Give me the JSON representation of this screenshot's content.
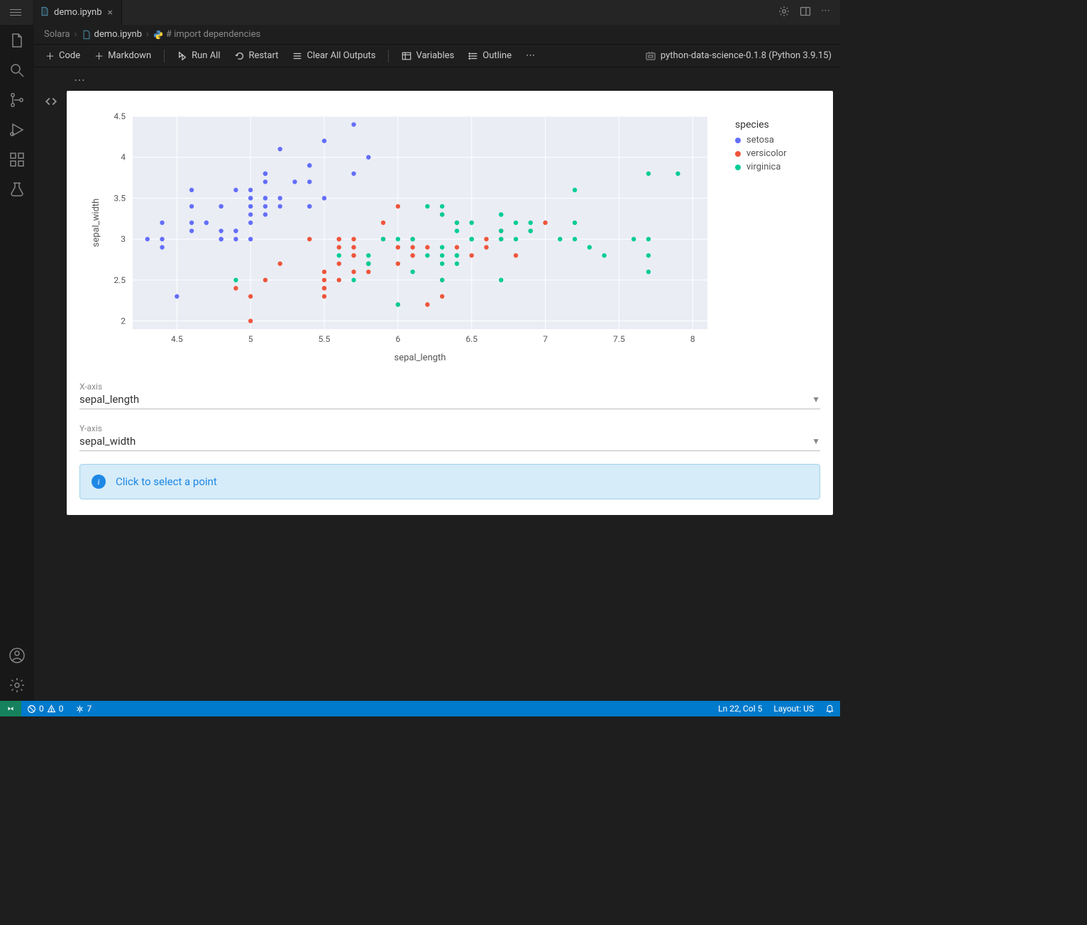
{
  "tab": {
    "title": "demo.ipynb"
  },
  "breadcrumb": {
    "root": "Solara",
    "file": "demo.ipynb",
    "symbol": "# import dependencies"
  },
  "toolbar": {
    "code": "Code",
    "markdown": "Markdown",
    "runall": "Run All",
    "restart": "Restart",
    "clear": "Clear All Outputs",
    "variables": "Variables",
    "outline": "Outline"
  },
  "kernel": {
    "name": "python-data-science-0.1.8 (Python 3.9.15)"
  },
  "chart": {
    "xlabel": "sepal_length",
    "ylabel": "sepal_width",
    "legend_title": "species",
    "legend": [
      "setosa",
      "versicolor",
      "virginica"
    ]
  },
  "chart_data": {
    "type": "scatter",
    "title": "",
    "xlabel": "sepal_length",
    "ylabel": "sepal_width",
    "xlim": [
      4.2,
      8.1
    ],
    "ylim": [
      1.9,
      4.5
    ],
    "xticks": [
      4.5,
      5,
      5.5,
      6,
      6.5,
      7,
      7.5,
      8
    ],
    "yticks": [
      2,
      2.5,
      3,
      3.5,
      4,
      4.5
    ],
    "legend_title": "species",
    "series": [
      {
        "name": "setosa",
        "color": "#636efa",
        "points": [
          [
            5.1,
            3.5
          ],
          [
            4.9,
            3.0
          ],
          [
            4.7,
            3.2
          ],
          [
            4.6,
            3.1
          ],
          [
            5.0,
            3.6
          ],
          [
            5.4,
            3.9
          ],
          [
            4.6,
            3.4
          ],
          [
            5.0,
            3.4
          ],
          [
            4.4,
            2.9
          ],
          [
            4.9,
            3.1
          ],
          [
            5.4,
            3.7
          ],
          [
            4.8,
            3.4
          ],
          [
            4.8,
            3.0
          ],
          [
            4.3,
            3.0
          ],
          [
            5.8,
            4.0
          ],
          [
            5.7,
            4.4
          ],
          [
            5.4,
            3.9
          ],
          [
            5.1,
            3.5
          ],
          [
            5.7,
            3.8
          ],
          [
            5.1,
            3.8
          ],
          [
            5.4,
            3.4
          ],
          [
            5.1,
            3.7
          ],
          [
            4.6,
            3.6
          ],
          [
            5.1,
            3.3
          ],
          [
            4.8,
            3.4
          ],
          [
            5.0,
            3.0
          ],
          [
            5.0,
            3.4
          ],
          [
            5.2,
            3.5
          ],
          [
            5.2,
            3.4
          ],
          [
            4.7,
            3.2
          ],
          [
            4.8,
            3.1
          ],
          [
            5.4,
            3.4
          ],
          [
            5.2,
            4.1
          ],
          [
            5.5,
            4.2
          ],
          [
            4.9,
            3.1
          ],
          [
            5.0,
            3.2
          ],
          [
            5.5,
            3.5
          ],
          [
            4.9,
            3.6
          ],
          [
            4.4,
            3.0
          ],
          [
            5.1,
            3.4
          ],
          [
            5.0,
            3.5
          ],
          [
            4.5,
            2.3
          ],
          [
            4.4,
            3.2
          ],
          [
            5.0,
            3.5
          ],
          [
            5.1,
            3.8
          ],
          [
            4.8,
            3.0
          ],
          [
            5.1,
            3.8
          ],
          [
            4.6,
            3.2
          ],
          [
            5.3,
            3.7
          ],
          [
            5.0,
            3.3
          ]
        ]
      },
      {
        "name": "versicolor",
        "color": "#ef553b",
        "points": [
          [
            7.0,
            3.2
          ],
          [
            6.4,
            3.2
          ],
          [
            6.9,
            3.1
          ],
          [
            5.5,
            2.3
          ],
          [
            6.5,
            2.8
          ],
          [
            5.7,
            2.8
          ],
          [
            6.3,
            3.3
          ],
          [
            4.9,
            2.4
          ],
          [
            6.6,
            2.9
          ],
          [
            5.2,
            2.7
          ],
          [
            5.0,
            2.0
          ],
          [
            5.9,
            3.0
          ],
          [
            6.0,
            2.2
          ],
          [
            6.1,
            2.9
          ],
          [
            5.6,
            2.9
          ],
          [
            6.7,
            3.1
          ],
          [
            5.6,
            3.0
          ],
          [
            5.8,
            2.7
          ],
          [
            6.2,
            2.2
          ],
          [
            5.6,
            2.5
          ],
          [
            5.9,
            3.2
          ],
          [
            6.1,
            2.8
          ],
          [
            6.3,
            2.5
          ],
          [
            6.1,
            2.8
          ],
          [
            6.4,
            2.9
          ],
          [
            6.6,
            3.0
          ],
          [
            6.8,
            2.8
          ],
          [
            6.7,
            3.0
          ],
          [
            6.0,
            2.9
          ],
          [
            5.7,
            2.6
          ],
          [
            5.5,
            2.4
          ],
          [
            5.5,
            2.4
          ],
          [
            5.8,
            2.7
          ],
          [
            6.0,
            2.7
          ],
          [
            5.4,
            3.0
          ],
          [
            6.0,
            3.4
          ],
          [
            6.7,
            3.1
          ],
          [
            6.3,
            2.3
          ],
          [
            5.6,
            3.0
          ],
          [
            5.5,
            2.5
          ],
          [
            5.5,
            2.6
          ],
          [
            6.1,
            3.0
          ],
          [
            5.8,
            2.6
          ],
          [
            5.0,
            2.3
          ],
          [
            5.6,
            2.7
          ],
          [
            5.7,
            3.0
          ],
          [
            5.7,
            2.9
          ],
          [
            6.2,
            2.9
          ],
          [
            5.1,
            2.5
          ],
          [
            5.7,
            2.8
          ]
        ]
      },
      {
        "name": "virginica",
        "color": "#00cc96",
        "points": [
          [
            6.3,
            3.3
          ],
          [
            5.8,
            2.7
          ],
          [
            7.1,
            3.0
          ],
          [
            6.3,
            2.9
          ],
          [
            6.5,
            3.0
          ],
          [
            7.6,
            3.0
          ],
          [
            4.9,
            2.5
          ],
          [
            7.3,
            2.9
          ],
          [
            6.7,
            2.5
          ],
          [
            7.2,
            3.6
          ],
          [
            6.5,
            3.2
          ],
          [
            6.4,
            2.7
          ],
          [
            6.8,
            3.0
          ],
          [
            5.7,
            2.5
          ],
          [
            5.8,
            2.8
          ],
          [
            6.4,
            3.2
          ],
          [
            6.5,
            3.0
          ],
          [
            7.7,
            3.8
          ],
          [
            7.7,
            2.6
          ],
          [
            6.0,
            2.2
          ],
          [
            6.9,
            3.2
          ],
          [
            5.6,
            2.8
          ],
          [
            7.7,
            2.8
          ],
          [
            6.3,
            2.7
          ],
          [
            6.7,
            3.3
          ],
          [
            7.2,
            3.2
          ],
          [
            6.2,
            2.8
          ],
          [
            6.1,
            3.0
          ],
          [
            6.4,
            2.8
          ],
          [
            7.2,
            3.0
          ],
          [
            7.4,
            2.8
          ],
          [
            7.9,
            3.8
          ],
          [
            6.4,
            2.8
          ],
          [
            6.3,
            2.8
          ],
          [
            6.1,
            2.6
          ],
          [
            7.7,
            3.0
          ],
          [
            6.3,
            3.4
          ],
          [
            6.4,
            3.1
          ],
          [
            6.0,
            3.0
          ],
          [
            6.9,
            3.1
          ],
          [
            6.7,
            3.1
          ],
          [
            6.9,
            3.1
          ],
          [
            5.8,
            2.7
          ],
          [
            6.8,
            3.2
          ],
          [
            6.7,
            3.3
          ],
          [
            6.7,
            3.0
          ],
          [
            6.3,
            2.5
          ],
          [
            6.5,
            3.0
          ],
          [
            6.2,
            3.4
          ],
          [
            5.9,
            3.0
          ]
        ]
      }
    ]
  },
  "controls": {
    "x": {
      "label": "X-axis",
      "value": "sepal_length"
    },
    "y": {
      "label": "Y-axis",
      "value": "sepal_width"
    }
  },
  "info": {
    "text": "Click to select a point"
  },
  "statusbar": {
    "errors": "0",
    "warnings": "0",
    "ports": "7",
    "cursor": "Ln 22, Col 5",
    "layout": "Layout: US"
  }
}
